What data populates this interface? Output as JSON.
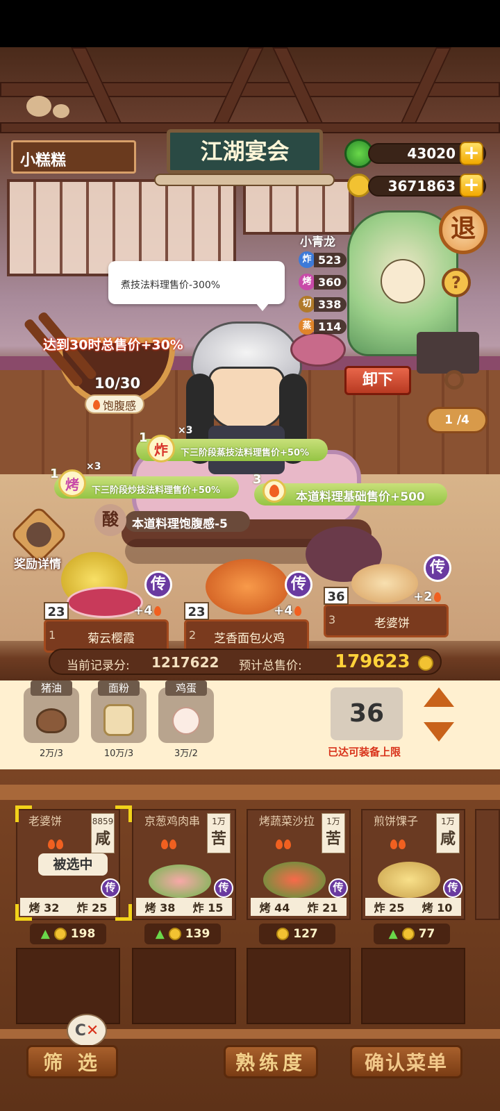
{
  "header": {
    "player_name": "小糕糕",
    "banner_title": "江湖宴会",
    "gems": "43020",
    "coins": "3671863",
    "plus_label": "+",
    "exit_label": "退",
    "help_label": "?"
  },
  "chef": {
    "name": "小青龙",
    "stats": [
      {
        "icon": "炸",
        "value": "523",
        "color": "#3d7ad8"
      },
      {
        "icon": "烤",
        "value": "360",
        "color": "#c84aa8"
      },
      {
        "icon": "切",
        "value": "338",
        "color": "#b07a2a"
      },
      {
        "icon": "蒸",
        "value": "114",
        "color": "#e0842a"
      }
    ],
    "unequip_label": "卸下",
    "page": "1 /4"
  },
  "speech_bubble": "煮技法料理售价-300%",
  "satiety": {
    "goal_text": "达到30时总售价+30%",
    "progress": "10/30",
    "label": "饱腹感"
  },
  "bonuses": [
    {
      "num": "1",
      "icon": "炸",
      "mult": "×3",
      "text": "下三阶段蒸技法料理售价+50%"
    },
    {
      "num": "1",
      "icon": "烤",
      "mult": "×3",
      "text": "下三阶段炒技法料理售价+50%"
    },
    {
      "num": "3",
      "icon": "",
      "mult": "",
      "text": "本道料理基础售价+500"
    }
  ],
  "sour_effect": {
    "icon": "酸",
    "text": "本道料理饱腹感-5"
  },
  "reward_label": "奖励详情",
  "menu": [
    {
      "count": "23",
      "index": "1",
      "name": "菊云樱霞",
      "bonus": "+4",
      "grade": "传"
    },
    {
      "count": "23",
      "index": "2",
      "name": "芝香面包火鸡",
      "bonus": "+4",
      "grade": "传"
    },
    {
      "count": "36",
      "index": "3",
      "name": "老婆饼",
      "bonus": "+2",
      "grade": "传"
    }
  ],
  "score": {
    "record_label": "当前记录分:",
    "record_value": "1217622",
    "total_label": "预计总售价:",
    "total_value": "179623"
  },
  "ingredients": [
    {
      "name": "猪油",
      "amount": "2万/3"
    },
    {
      "name": "面粉",
      "amount": "10万/3"
    },
    {
      "name": "鸡蛋",
      "amount": "3万/2"
    }
  ],
  "quantity": {
    "value": "36",
    "note": "已达可装备上限"
  },
  "recipes": [
    {
      "name": "老婆饼",
      "qty": "8859",
      "taste": "咸",
      "grade": "传",
      "s1": "烤",
      "v1": "32",
      "s2": "炸",
      "v2": "25",
      "price": "198",
      "selected": "被选中"
    },
    {
      "name": "京葱鸡肉串",
      "qty": "1万",
      "taste": "苦",
      "grade": "传",
      "s1": "烤",
      "v1": "38",
      "s2": "炸",
      "v2": "15",
      "price": "139"
    },
    {
      "name": "烤蔬菜沙拉",
      "qty": "1万",
      "taste": "苦",
      "grade": "传",
      "s1": "烤",
      "v1": "44",
      "s2": "炸",
      "v2": "21",
      "price": "127"
    },
    {
      "name": "煎饼馃子",
      "qty": "1万",
      "taste": "咸",
      "grade": "传",
      "s1": "炸",
      "v1": "25",
      "s2": "烤",
      "v2": "10",
      "price": "77"
    }
  ],
  "bottom": {
    "filter_label": "筛 选",
    "proficiency_label": "熟练度",
    "confirm_label": "确认菜单"
  }
}
